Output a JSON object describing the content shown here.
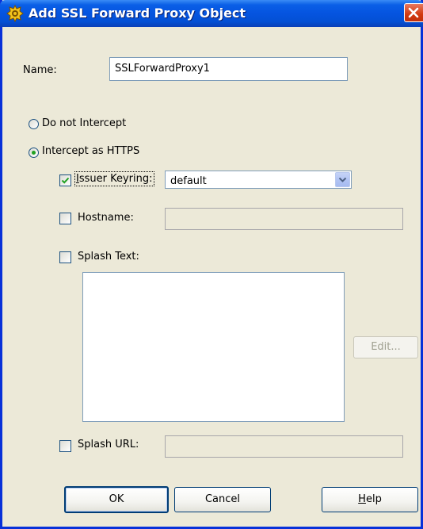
{
  "window": {
    "title": "Add SSL Forward Proxy Object"
  },
  "name_field": {
    "label": "Name:",
    "value": "SSLForwardProxy1"
  },
  "mode": {
    "options": [
      {
        "label": "Do not Intercept",
        "selected": false
      },
      {
        "label": "Intercept as HTTPS",
        "selected": true
      }
    ]
  },
  "issuer_keyring": {
    "checked": true,
    "label_first": "I",
    "label_rest": "ssuer Keyring:",
    "selected_value": "default"
  },
  "hostname": {
    "checked": false,
    "label": "Hostname:",
    "value": ""
  },
  "splash_text": {
    "checked": false,
    "label": "Splash Text:",
    "value": "",
    "edit_button": "Edit..."
  },
  "splash_url": {
    "checked": false,
    "label": "Splash URL:",
    "value": ""
  },
  "buttons": {
    "ok": "OK",
    "cancel": "Cancel",
    "help_mnemonic": "H",
    "help_rest": "elp"
  },
  "icons": {
    "title": "app-gear-icon",
    "close": "close-icon",
    "dropdown": "chevron-down-icon",
    "check": "check-icon"
  },
  "colors": {
    "titlebar": "#0554e0",
    "dialog_bg": "#ece9d8",
    "close": "#d23a10",
    "radio_dot": "#21a121",
    "check": "#21a121"
  }
}
